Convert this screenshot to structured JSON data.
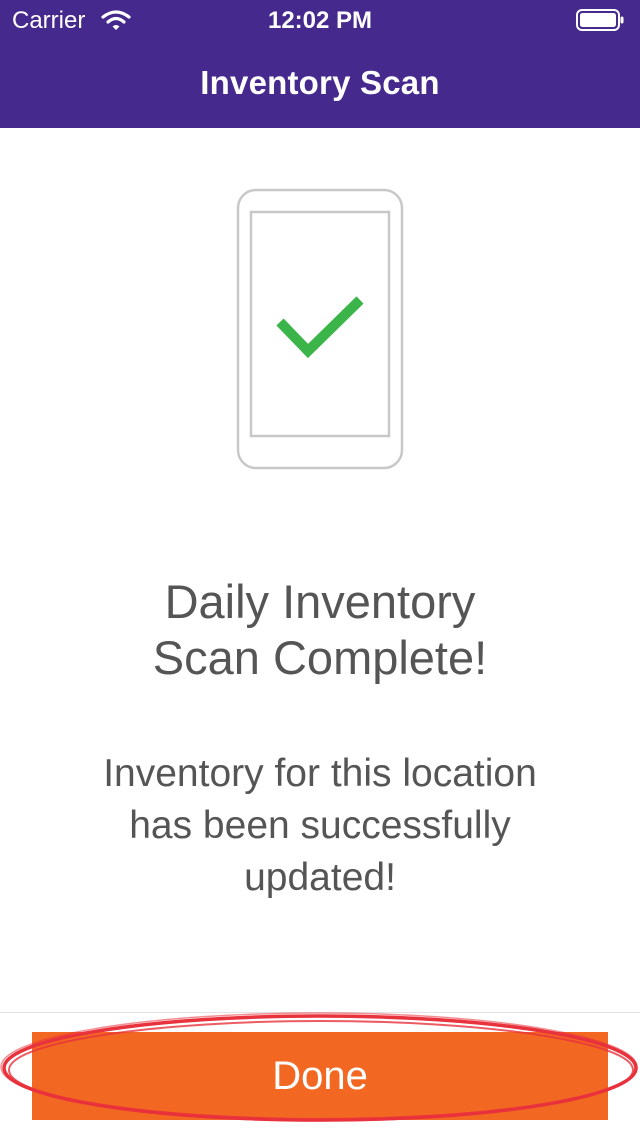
{
  "status_bar": {
    "carrier": "Carrier",
    "time": "12:02 PM",
    "wifi_icon": "wifi-icon",
    "battery_icon": "battery-full-icon"
  },
  "nav": {
    "title": "Inventory Scan"
  },
  "illustration": {
    "icon": "phone-checkmark-icon",
    "check_color": "#3bb54a",
    "outline_color": "#c8c8c8"
  },
  "content": {
    "headline_line1": "Daily Inventory",
    "headline_line2": "Scan Complete!",
    "message_line1": "Inventory for this location",
    "message_line2": "has been successfully",
    "message_line3": "updated!"
  },
  "footer": {
    "done_label": "Done"
  },
  "colors": {
    "header": "#46298c",
    "button": "#f26722",
    "text": "#555555",
    "annotation_ring": "#e8323c"
  }
}
